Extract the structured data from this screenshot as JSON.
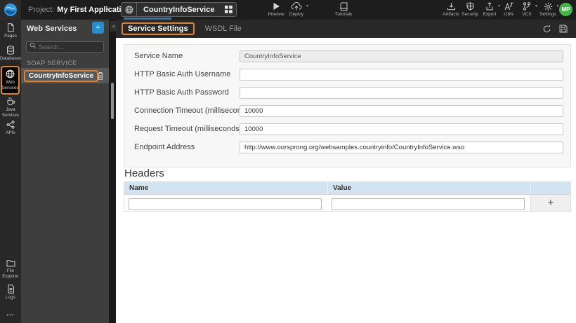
{
  "icons": {
    "breadcrumb_chevron": "›",
    "dropdown_caret": "▾",
    "collapse_glyph": "«",
    "panel_add_glyph": "+",
    "table_add_glyph": "+",
    "more_glyph": "•••"
  },
  "colors": {
    "accent_orange": "#E08330",
    "add_button_blue": "#1E8FD5",
    "progress_blue": "#2878B5",
    "avatar_green": "#44B549",
    "table_header_blue": "#D2E4F0"
  },
  "topbar": {
    "project_label": "Project:",
    "project_name": "My First Application",
    "service_tab_name": "CountryInfoService",
    "actions": {
      "preview": "Preview",
      "deploy": "Deploy",
      "tutorials": "Tutorials",
      "artifacts": "Artifacts",
      "security": "Security",
      "export": "Export",
      "i18n": "I18N",
      "vcs": "VCS",
      "settings": "Settings"
    },
    "avatar_initials": "MP"
  },
  "rail": {
    "items": [
      {
        "label": "Pages",
        "selected": false
      },
      {
        "label": "Databases",
        "selected": false
      },
      {
        "label": "Web Services",
        "selected": true
      },
      {
        "label": "Java Services",
        "selected": false
      },
      {
        "label": "APIs",
        "selected": false
      },
      {
        "label": "File Explorer",
        "selected": false
      },
      {
        "label": "Logs",
        "selected": false
      }
    ]
  },
  "panel": {
    "title": "Web Services",
    "search_placeholder": "Search...",
    "section_label": "SOAP SERVICE",
    "items": [
      {
        "name": "CountryInfoService",
        "selected": true
      }
    ]
  },
  "main": {
    "tabs": [
      {
        "label": "Service Settings",
        "active": true
      },
      {
        "label": "WSDL File",
        "active": false
      }
    ],
    "form": {
      "fields": [
        {
          "label": "Service Name",
          "value": "CountryInfoService",
          "disabled": true
        },
        {
          "label": "HTTP Basic Auth Username",
          "value": "",
          "disabled": false
        },
        {
          "label": "HTTP Basic Auth Password",
          "value": "",
          "disabled": false
        },
        {
          "label": "Connection Timeout (milliseconds)",
          "value": "10000",
          "disabled": false
        },
        {
          "label": "Request Timeout (milliseconds)",
          "value": "10000",
          "disabled": false
        },
        {
          "label": "Endpoint Address",
          "value": "http://www.oorsprong.org/websamples.countryinfo/CountryInfoService.wso",
          "disabled": false
        }
      ]
    },
    "headers_section": {
      "title": "Headers",
      "columns": [
        "Name",
        "Value"
      ],
      "rows": [
        {
          "name": "",
          "value": ""
        }
      ]
    }
  }
}
